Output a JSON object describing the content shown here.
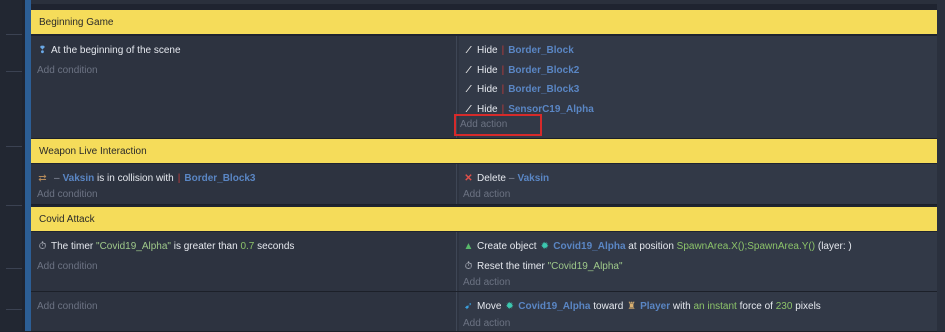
{
  "groups": {
    "g1": "Beginning Game",
    "g2": "Weapon Live Interaction",
    "g3": "Covid Attack"
  },
  "common": {
    "add_condition": "Add condition",
    "add_action": "Add action"
  },
  "event1": {
    "condition": "At the beginning of the scene",
    "actions": [
      {
        "verb": "Hide",
        "object": "Border_Block"
      },
      {
        "verb": "Hide",
        "object": "Border_Block2"
      },
      {
        "verb": "Hide",
        "object": "Border_Block3"
      },
      {
        "verb": "Hide",
        "object": "SensorC19_Alpha"
      }
    ]
  },
  "event2": {
    "cond_object": "Vaksin",
    "cond_text": "is in collision with",
    "cond_target": "Border_Block3",
    "action_verb": "Delete",
    "action_object": "Vaksin"
  },
  "event3": {
    "cond_prefix": "The timer",
    "cond_timer": "\"Covid19_Alpha\"",
    "cond_mid": "is greater than",
    "cond_value": "0.7",
    "cond_unit": "seconds",
    "create_prefix": "Create object",
    "create_object": "Covid19_Alpha",
    "create_mid": "at position",
    "create_pos": "SpawnArea.X();SpawnArea.Y()",
    "create_layer": "(layer: )",
    "reset_prefix": "Reset the timer",
    "reset_timer": "\"Covid19_Alpha\""
  },
  "event4": {
    "move_verb": "Move",
    "move_object": "Covid19_Alpha",
    "toward": "toward",
    "target": "Player",
    "with": "with",
    "instant": "an instant",
    "force_of": "force of",
    "force_value": "230",
    "unit": "pixels"
  },
  "icons": {
    "scene": "scene-start-icon",
    "hide": "hide-flag-icon",
    "collision": "collision-icon",
    "delete": "delete-x-icon",
    "timer": "timer-icon",
    "create": "create-object-icon",
    "sprite": "sprite-object-icon",
    "move": "move-force-icon",
    "player": "player-object-icon"
  },
  "colors": {
    "group_header": "#f5dc5a",
    "object_name": "#5a86c4",
    "value": "#8cc36a",
    "highlight": "#d62a2a"
  }
}
